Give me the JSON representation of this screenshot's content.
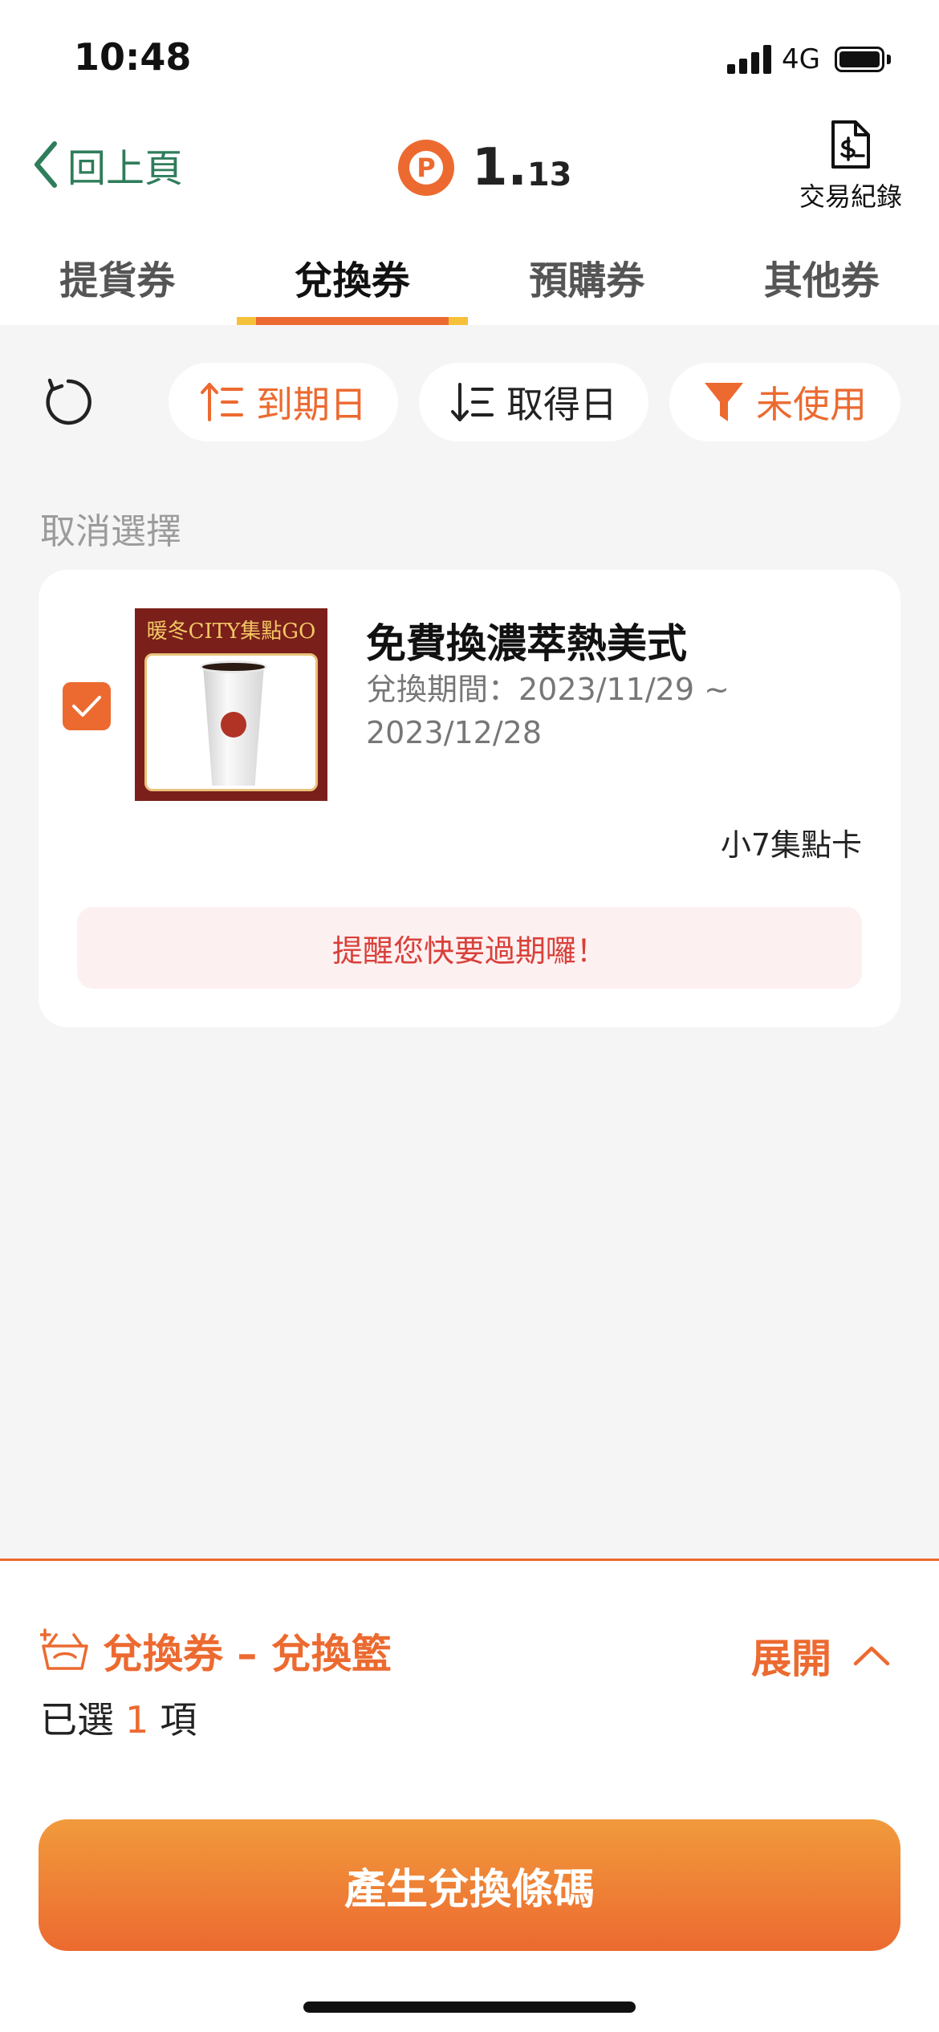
{
  "status_bar": {
    "time": "10:48",
    "network": "4G"
  },
  "nav": {
    "back_label": "回上頁",
    "points_badge": "P",
    "points_integer": "1.",
    "points_decimal": "13",
    "records_label": "交易紀錄"
  },
  "tabs": [
    {
      "label": "提貨券",
      "active": false
    },
    {
      "label": "兌換券",
      "active": true
    },
    {
      "label": "預購券",
      "active": false
    },
    {
      "label": "其他券",
      "active": false
    }
  ],
  "toolbar": {
    "sort_expiry": "到期日",
    "sort_acquired": "取得日",
    "filter_unused": "未使用"
  },
  "cancel_selection": "取消選擇",
  "coupons": [
    {
      "thumb_banner": "暖冬CITY集點GO",
      "title": "免費換濃萃熱美式",
      "period_line1": "兌換期間：2023/11/29 ~",
      "period_line2": "2023/12/28",
      "issuer": "小7集點卡",
      "reminder": "提醒您快要過期囉！",
      "checked": true
    }
  ],
  "basket": {
    "label": "兌換券 – 兌換籃",
    "expand_label": "展開",
    "selected_prefix": "已選",
    "selected_count": "1",
    "selected_suffix": "項"
  },
  "cta_label": "產生兌換條碼",
  "colors": {
    "accent": "#ec6a30",
    "back_green": "#2f7d5a",
    "reminder_text": "#d9403a"
  }
}
